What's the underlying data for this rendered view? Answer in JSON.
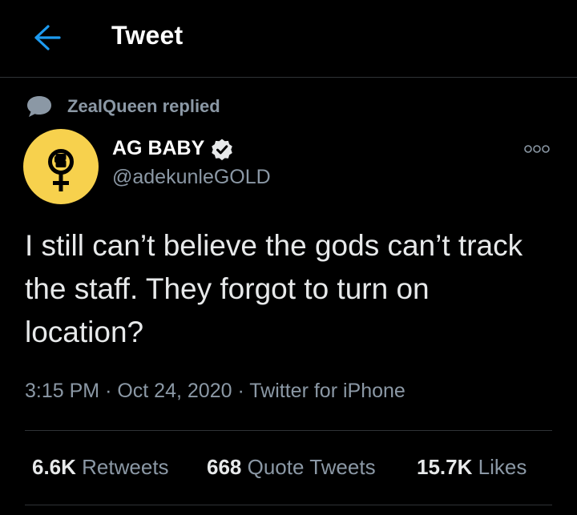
{
  "colors": {
    "background": "#000000",
    "accent": "#1d9bf0",
    "secondary_text": "#8b98a5",
    "avatar_bg": "#f7d14d",
    "divider": "#2f3336"
  },
  "header": {
    "back_icon": "arrow-left-icon",
    "title": "Tweet"
  },
  "reply_context": {
    "icon": "speech-bubble-icon",
    "text": "ZealQueen replied"
  },
  "author": {
    "name": "AG BABY",
    "handle": "@adekunleGOLD",
    "verified": true,
    "avatar_icon": "raised-fist-venus-icon"
  },
  "more_icon": "more-dots-icon",
  "tweet": {
    "text": "I still can’t believe the gods can’t track the staff. They forgot to turn on location?",
    "time": "3:15 PM",
    "separator": "·",
    "date": "Oct 24, 2020",
    "source": "Twitter for iPhone"
  },
  "stats": {
    "retweets_count": "6.6K",
    "retweets_label": "Retweets",
    "quotes_count": "668",
    "quotes_label": "Quote Tweets",
    "likes_count": "15.7K",
    "likes_label": "Likes"
  }
}
